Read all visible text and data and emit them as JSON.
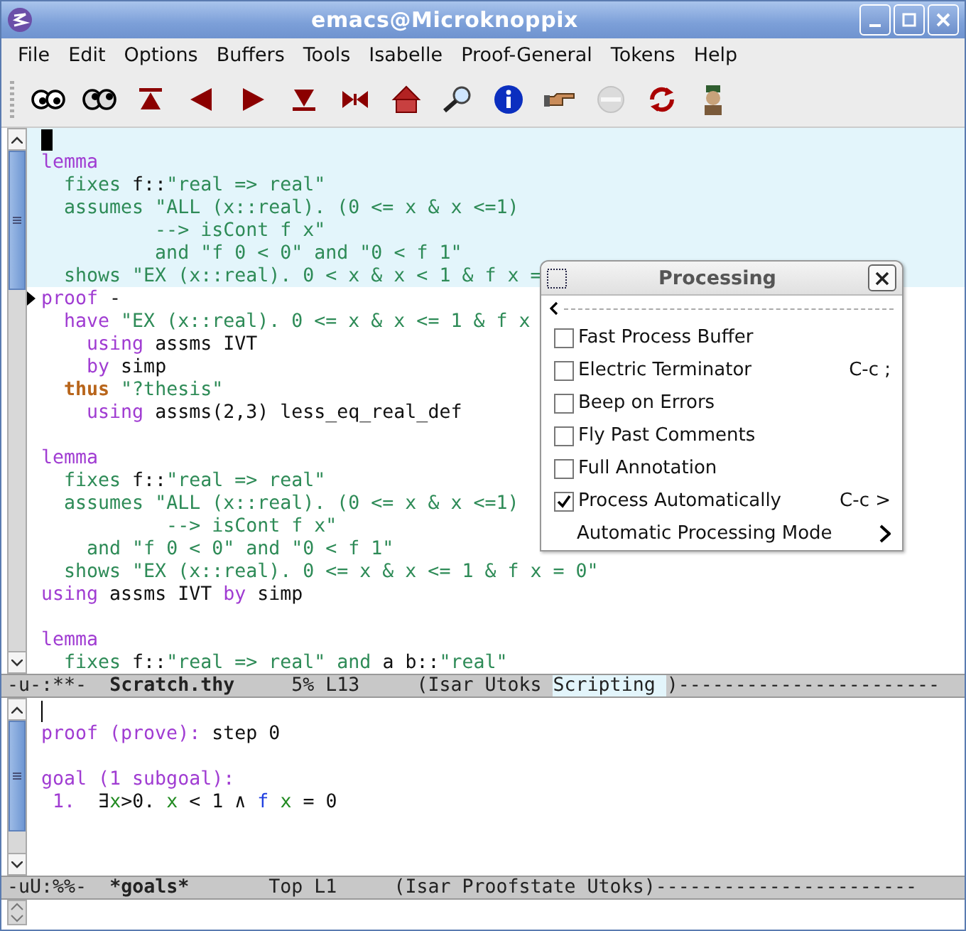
{
  "window": {
    "title": "emacs@Microknoppix"
  },
  "menubar": [
    "File",
    "Edit",
    "Options",
    "Buffers",
    "Tools",
    "Isabelle",
    "Proof-General",
    "Tokens",
    "Help"
  ],
  "toolbar": [
    {
      "kind": "eyes",
      "disabled": false
    },
    {
      "kind": "eyes-wide",
      "disabled": false
    },
    {
      "kind": "to-top",
      "disabled": false
    },
    {
      "kind": "back",
      "disabled": false
    },
    {
      "kind": "forward",
      "disabled": false
    },
    {
      "kind": "to-end",
      "disabled": false
    },
    {
      "kind": "restart",
      "disabled": false
    },
    {
      "kind": "home",
      "disabled": false
    },
    {
      "kind": "find",
      "disabled": false
    },
    {
      "kind": "info",
      "disabled": false
    },
    {
      "kind": "pointer",
      "disabled": false
    },
    {
      "kind": "stop",
      "disabled": true
    },
    {
      "kind": "refresh",
      "disabled": false
    },
    {
      "kind": "person",
      "disabled": false
    }
  ],
  "editor": {
    "lines": [
      {
        "kind": "cursor",
        "processed": true,
        "marker": false
      },
      {
        "kind": "code",
        "processed": true,
        "marker": false,
        "tokens": [
          {
            "kind": "kw",
            "t": "lemma"
          }
        ]
      },
      {
        "kind": "code",
        "processed": true,
        "marker": false,
        "tokens": [
          {
            "kind": "minor",
            "t": "  fixes "
          },
          {
            "kind": "plain",
            "t": "f::"
          },
          {
            "kind": "str",
            "t": "\"real => real\""
          }
        ]
      },
      {
        "kind": "code",
        "processed": true,
        "marker": false,
        "tokens": [
          {
            "kind": "minor",
            "t": "  assumes "
          },
          {
            "kind": "str",
            "t": "\"ALL (x::real). (0 <= x & x <=1)"
          }
        ]
      },
      {
        "kind": "code",
        "processed": true,
        "marker": false,
        "tokens": [
          {
            "kind": "str",
            "t": "          --> isCont f x\""
          }
        ]
      },
      {
        "kind": "code",
        "processed": true,
        "marker": false,
        "tokens": [
          {
            "kind": "minor",
            "t": "          and "
          },
          {
            "kind": "str",
            "t": "\"f 0 < 0\""
          },
          {
            "kind": "minor",
            "t": " and "
          },
          {
            "kind": "str",
            "t": "\"0 < f 1\""
          }
        ]
      },
      {
        "kind": "code",
        "processed": true,
        "marker": false,
        "tokens": [
          {
            "kind": "minor",
            "t": "  shows "
          },
          {
            "kind": "str",
            "t": "\"EX (x::real). 0 < x & x < 1 & f x ="
          }
        ]
      },
      {
        "kind": "code",
        "processed": false,
        "marker": true,
        "tokens": [
          {
            "kind": "kw",
            "t": "proof"
          },
          {
            "kind": "plain",
            "t": " -"
          }
        ]
      },
      {
        "kind": "code",
        "processed": false,
        "marker": false,
        "tokens": [
          {
            "kind": "kw",
            "t": "  have "
          },
          {
            "kind": "str",
            "t": "\"EX (x::real). 0 <= x & x <= 1 & f x"
          }
        ]
      },
      {
        "kind": "code",
        "processed": false,
        "marker": false,
        "tokens": [
          {
            "kind": "kw",
            "t": "    using "
          },
          {
            "kind": "plain",
            "t": "assms IVT"
          }
        ]
      },
      {
        "kind": "code",
        "processed": false,
        "marker": false,
        "tokens": [
          {
            "kind": "kw",
            "t": "    by "
          },
          {
            "kind": "plain",
            "t": "simp"
          }
        ]
      },
      {
        "kind": "code",
        "processed": false,
        "marker": false,
        "tokens": [
          {
            "kind": "goal",
            "t": "  thus "
          },
          {
            "kind": "str",
            "t": "\"?thesis\""
          }
        ]
      },
      {
        "kind": "code",
        "processed": false,
        "marker": false,
        "tokens": [
          {
            "kind": "kw",
            "t": "    using "
          },
          {
            "kind": "plain",
            "t": "assms(2,3) less_eq_real_def"
          }
        ]
      },
      {
        "kind": "blank",
        "processed": false,
        "marker": false
      },
      {
        "kind": "code",
        "processed": false,
        "marker": false,
        "tokens": [
          {
            "kind": "kw",
            "t": "lemma"
          }
        ]
      },
      {
        "kind": "code",
        "processed": false,
        "marker": false,
        "tokens": [
          {
            "kind": "minor",
            "t": "  fixes "
          },
          {
            "kind": "plain",
            "t": "f::"
          },
          {
            "kind": "str",
            "t": "\"real => real\""
          }
        ]
      },
      {
        "kind": "code",
        "processed": false,
        "marker": false,
        "tokens": [
          {
            "kind": "minor",
            "t": "  assumes "
          },
          {
            "kind": "str",
            "t": "\"ALL (x::real). (0 <= x & x <=1)"
          }
        ]
      },
      {
        "kind": "code",
        "processed": false,
        "marker": false,
        "tokens": [
          {
            "kind": "str",
            "t": "           --> isCont f x\""
          }
        ]
      },
      {
        "kind": "code",
        "processed": false,
        "marker": false,
        "tokens": [
          {
            "kind": "minor",
            "t": "    and "
          },
          {
            "kind": "str",
            "t": "\"f 0 < 0\""
          },
          {
            "kind": "minor",
            "t": " and "
          },
          {
            "kind": "str",
            "t": "\"0 < f 1\""
          }
        ]
      },
      {
        "kind": "code",
        "processed": false,
        "marker": false,
        "tokens": [
          {
            "kind": "minor",
            "t": "  shows "
          },
          {
            "kind": "str",
            "t": "\"EX (x::real). 0 <= x & x <= 1 & f x = 0\""
          }
        ]
      },
      {
        "kind": "code",
        "processed": false,
        "marker": false,
        "tokens": [
          {
            "kind": "kw",
            "t": "using "
          },
          {
            "kind": "plain",
            "t": "assms IVT "
          },
          {
            "kind": "kw",
            "t": "by "
          },
          {
            "kind": "plain",
            "t": "simp"
          }
        ]
      },
      {
        "kind": "blank",
        "processed": false,
        "marker": false
      },
      {
        "kind": "code",
        "processed": false,
        "marker": false,
        "tokens": [
          {
            "kind": "kw",
            "t": "lemma"
          }
        ]
      },
      {
        "kind": "code",
        "processed": false,
        "marker": false,
        "tokens": [
          {
            "kind": "minor",
            "t": "  fixes "
          },
          {
            "kind": "plain",
            "t": "f::"
          },
          {
            "kind": "str",
            "t": "\"real => real\""
          },
          {
            "kind": "minor",
            "t": " and "
          },
          {
            "kind": "plain",
            "t": "a b::"
          },
          {
            "kind": "str",
            "t": "\"real\""
          }
        ]
      }
    ]
  },
  "modeline": [
    {
      "kind": "plain",
      "t": "-u-:**-  "
    },
    {
      "kind": "bold",
      "t": "Scratch.thy"
    },
    {
      "kind": "plain",
      "t": "     5% L13     (Isar Utoks "
    },
    {
      "kind": "hl",
      "t": "Scripting "
    },
    {
      "kind": "plain",
      "t": ")-----------------------"
    }
  ],
  "popup": {
    "title": "Processing",
    "items": [
      {
        "kind": "toggle",
        "label": "Fast Process Buffer",
        "checked": false
      },
      {
        "kind": "toggle",
        "label": "Electric Terminator",
        "checked": false,
        "shortcut": "C-c ;"
      },
      {
        "kind": "toggle",
        "label": "Beep on Errors",
        "checked": false
      },
      {
        "kind": "toggle",
        "label": "Fly Past Comments",
        "checked": false
      },
      {
        "kind": "toggle",
        "label": "Full Annotation",
        "checked": false
      },
      {
        "kind": "toggle",
        "label": "Process Automatically",
        "checked": true,
        "shortcut": "C-c >"
      },
      {
        "kind": "submenu",
        "label": "Automatic Processing Mode"
      }
    ]
  },
  "goals": {
    "lines": [
      {
        "kind": "cursor"
      },
      {
        "kind": "code",
        "tokens": [
          {
            "kind": "kw",
            "t": "proof (prove):"
          },
          {
            "kind": "plain",
            "t": " step 0"
          }
        ]
      },
      {
        "kind": "blank"
      },
      {
        "kind": "code",
        "tokens": [
          {
            "kind": "kw",
            "t": "goal (1 subgoal):"
          }
        ]
      },
      {
        "kind": "code",
        "tokens": [
          {
            "kind": "kw",
            "t": " 1."
          },
          {
            "kind": "plain",
            "t": "  ∃"
          },
          {
            "kind": "var",
            "t": "x"
          },
          {
            "kind": "plain",
            "t": ">0. "
          },
          {
            "kind": "var",
            "t": "x"
          },
          {
            "kind": "plain",
            "t": " < 1 ∧ "
          },
          {
            "kind": "fn",
            "t": "f"
          },
          {
            "kind": "var",
            "t": " x"
          },
          {
            "kind": "plain",
            "t": " = 0"
          }
        ]
      }
    ]
  },
  "goals_modeline": [
    {
      "kind": "plain",
      "t": "-uU:%%-  "
    },
    {
      "kind": "bold",
      "t": "*goals*"
    },
    {
      "kind": "plain",
      "t": "       Top L1     (Isar Proofstate Utoks)-----------------------"
    }
  ]
}
